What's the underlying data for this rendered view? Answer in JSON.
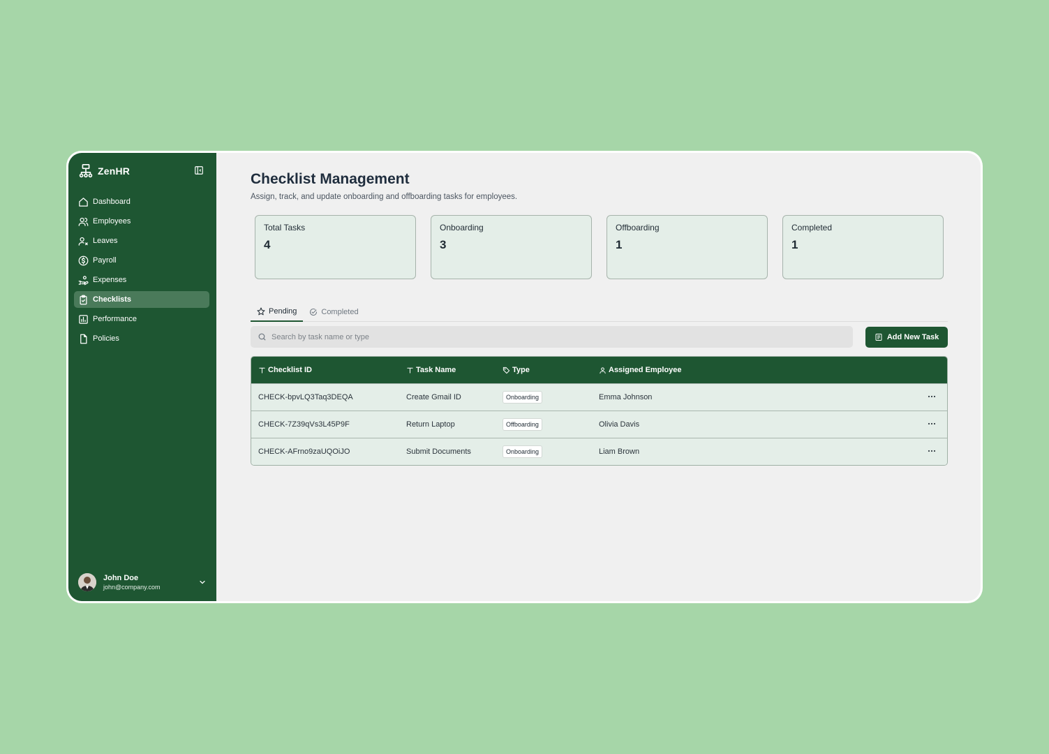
{
  "sidebar": {
    "brand": "ZenHR",
    "items": [
      {
        "label": "Dashboard",
        "icon": "home-icon"
      },
      {
        "label": "Employees",
        "icon": "users-icon"
      },
      {
        "label": "Leaves",
        "icon": "user-x-icon"
      },
      {
        "label": "Payroll",
        "icon": "dollar-circle-icon"
      },
      {
        "label": "Expenses",
        "icon": "hand-coins-icon"
      },
      {
        "label": "Checklists",
        "icon": "clipboard-check-icon",
        "active": true
      },
      {
        "label": "Performance",
        "icon": "bar-chart-icon"
      },
      {
        "label": "Policies",
        "icon": "file-icon"
      }
    ],
    "user": {
      "name": "John Doe",
      "email": "john@company.com"
    }
  },
  "header": {
    "title": "Checklist Management",
    "subtitle": "Assign, track, and update onboarding and offboarding tasks for employees."
  },
  "stats": [
    {
      "label": "Total Tasks",
      "value": "4"
    },
    {
      "label": "Onboarding",
      "value": "3"
    },
    {
      "label": "Offboarding",
      "value": "1"
    },
    {
      "label": "Completed",
      "value": "1"
    }
  ],
  "tabs": [
    {
      "label": "Pending",
      "active": true
    },
    {
      "label": "Completed",
      "active": false
    }
  ],
  "search": {
    "placeholder": "Search by task name or type",
    "value": ""
  },
  "add_button": "Add New Task",
  "table": {
    "columns": [
      "Checklist ID",
      "Task Name",
      "Type",
      "Assigned Employee"
    ],
    "rows": [
      {
        "id": "CHECK-bpvLQ3Taq3DEQA",
        "task": "Create Gmail ID",
        "type": "Onboarding",
        "employee": "Emma Johnson"
      },
      {
        "id": "CHECK-7Z39qVs3L45P9F",
        "task": "Return Laptop",
        "type": "Offboarding",
        "employee": "Olivia Davis"
      },
      {
        "id": "CHECK-AFrno9zaUQOiJO",
        "task": "Submit Documents",
        "type": "Onboarding",
        "employee": "Liam Brown"
      }
    ]
  },
  "colors": {
    "background": "#a6d6a8",
    "sidebar": "#1e5632",
    "accent": "#1e5632",
    "card": "#e4eee8"
  }
}
